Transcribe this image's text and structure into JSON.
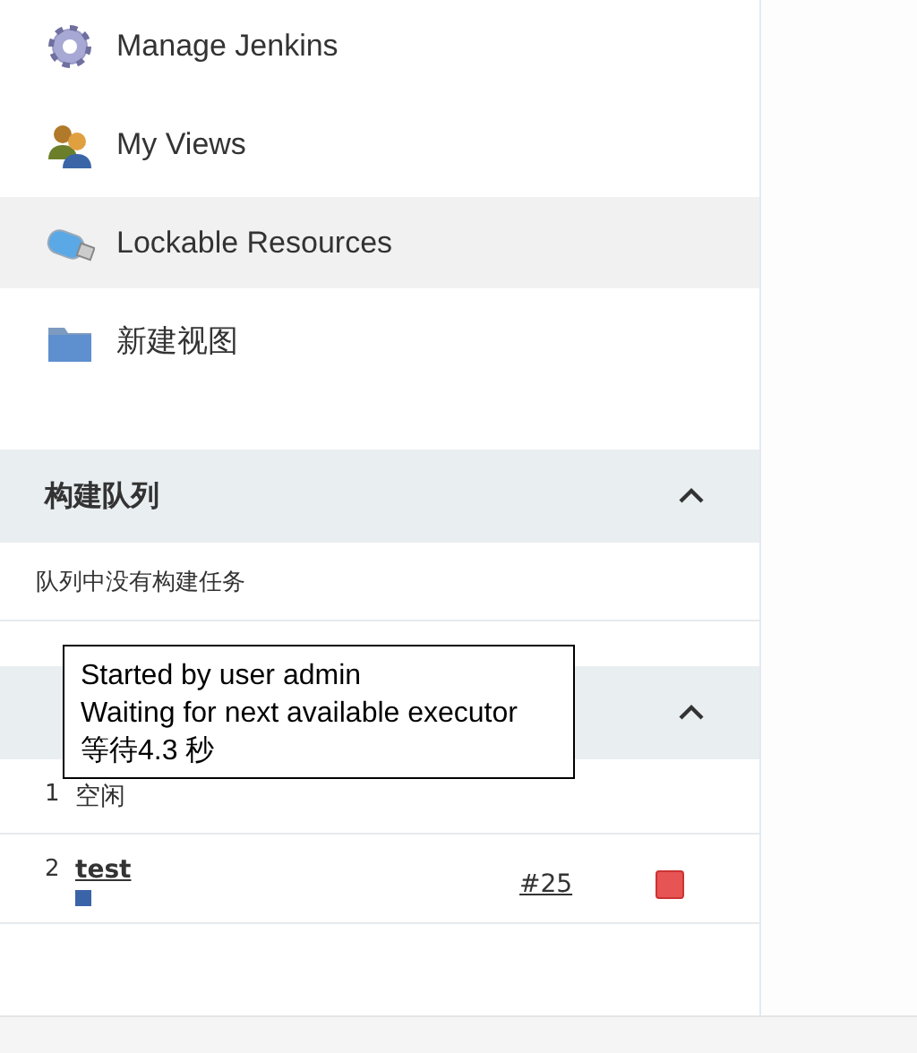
{
  "sidebar": {
    "items": [
      {
        "label": "Manage Jenkins",
        "selected": false
      },
      {
        "label": "My Views",
        "selected": false
      },
      {
        "label": "Lockable Resources",
        "selected": true
      },
      {
        "label": "新建视图",
        "selected": false
      }
    ]
  },
  "build_queue": {
    "title": "构建队列",
    "expanded": true,
    "empty_message": "队列中没有构建任务"
  },
  "executors": {
    "expanded": true,
    "rows": [
      {
        "number": "1",
        "status": "空闲",
        "kind": "idle"
      },
      {
        "number": "2",
        "job": "test",
        "build": "#25",
        "kind": "busy",
        "level": 0.1
      }
    ]
  },
  "tooltip": {
    "lines": [
      "Started by user admin",
      "Waiting for next available executor",
      "等待4.3 秒"
    ]
  }
}
